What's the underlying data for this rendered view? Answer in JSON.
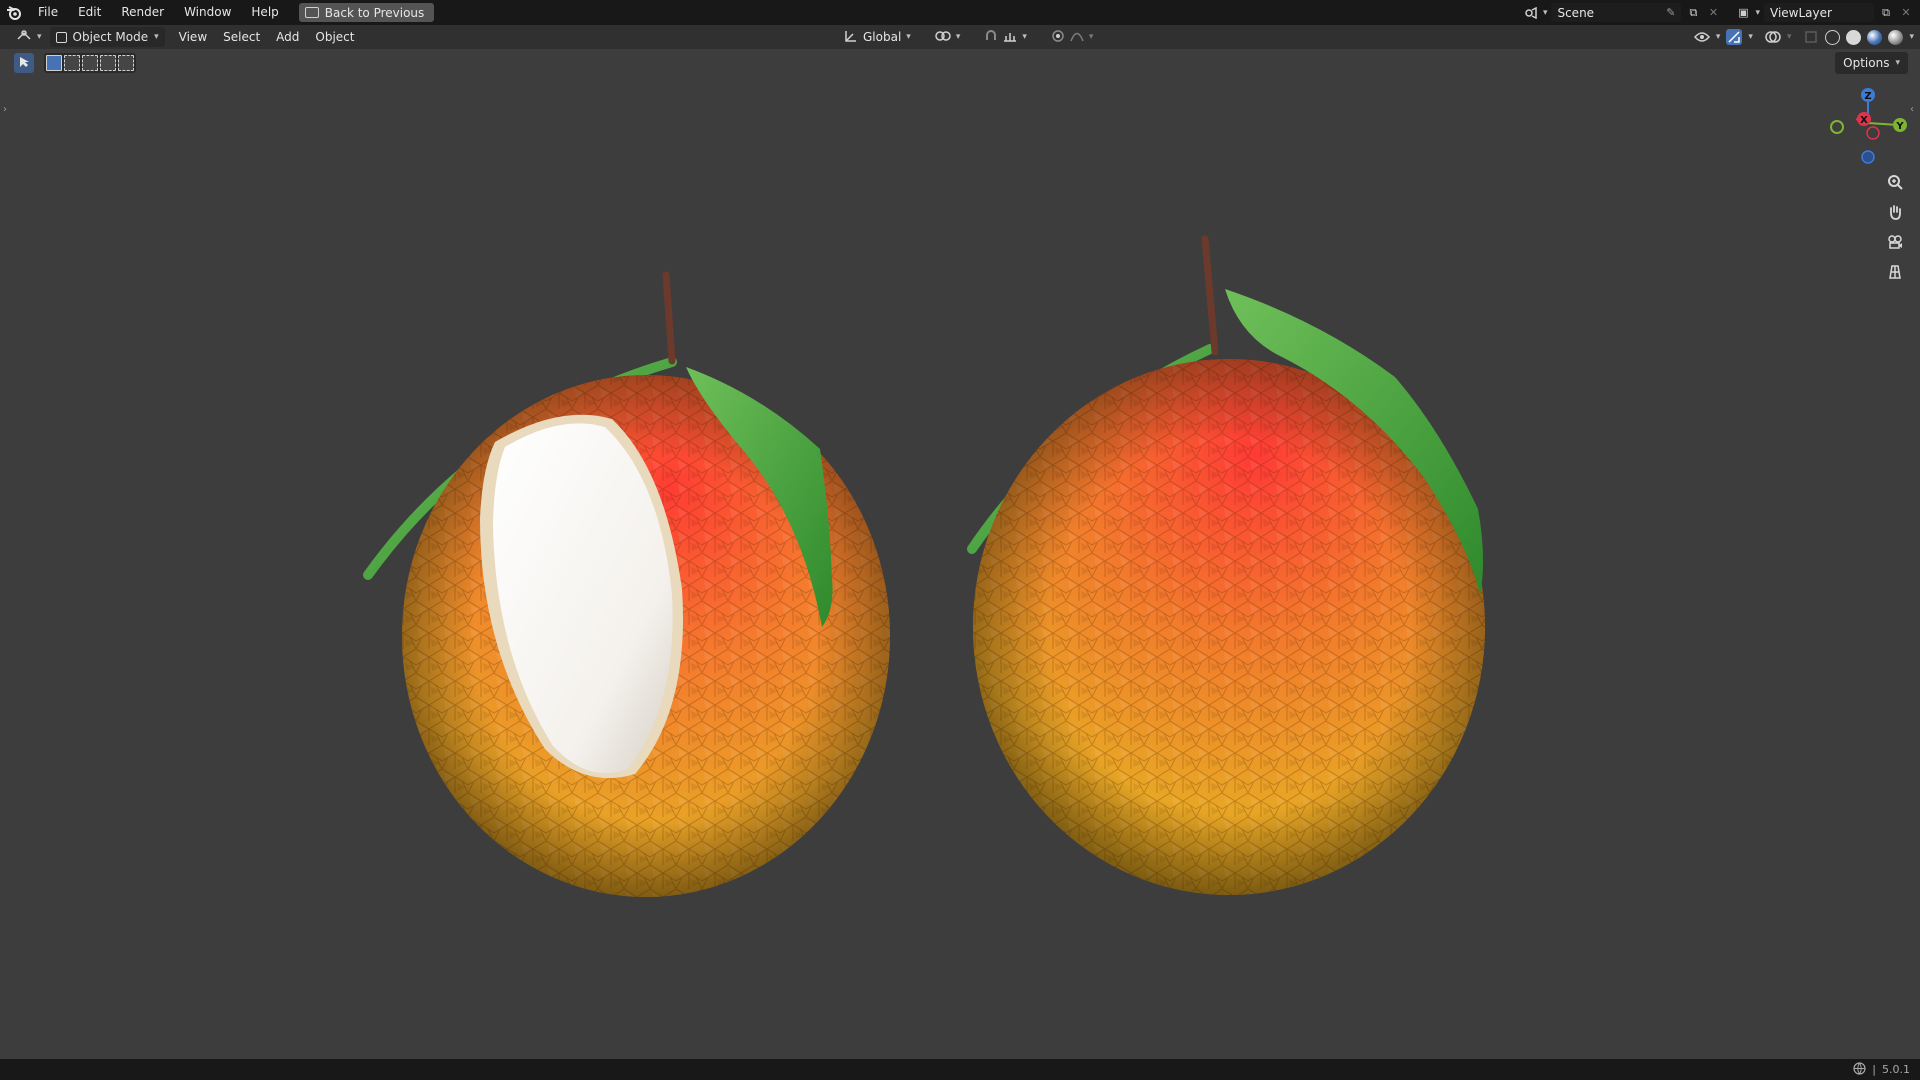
{
  "topbar": {
    "menu": [
      "File",
      "Edit",
      "Render",
      "Window",
      "Help"
    ],
    "back_button": "Back to Previous",
    "scene_name": "Scene",
    "view_layer": "ViewLayer"
  },
  "header": {
    "mode": "Object Mode",
    "menu": [
      "View",
      "Select",
      "Add",
      "Object"
    ],
    "orientation": "Global"
  },
  "viewport": {
    "options_label": "Options",
    "gizmo_axes": {
      "x": "X",
      "y": "Y",
      "z": "Z"
    },
    "colors": {
      "background": "#3d3d3d",
      "x_axis": "#e0324a",
      "y_axis": "#7eb530",
      "z_axis": "#3d7bd6",
      "active": "#4772b3"
    },
    "objects": [
      {
        "name": "lychee-peeled",
        "icon": "lychee-icon"
      },
      {
        "name": "lychee-whole",
        "icon": "lychee-icon"
      }
    ]
  },
  "statusbar": {
    "version": "5.0.1"
  }
}
